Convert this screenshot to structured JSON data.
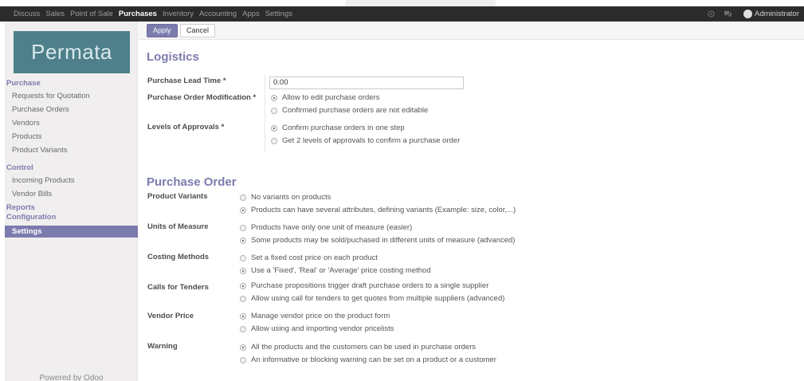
{
  "topnav": {
    "items": [
      "Discuss",
      "Sales",
      "Point of Sale",
      "Purchases",
      "Inventory",
      "Accounting",
      "Apps",
      "Settings"
    ],
    "active": "Purchases",
    "user": "Administrator",
    "icons": [
      "help-circle-icon",
      "chat-icon"
    ]
  },
  "sidebar": {
    "logo": "Permata",
    "sections": [
      {
        "title": "Purchase",
        "items": [
          "Requests for Quotation",
          "Purchase Orders",
          "Vendors",
          "Products",
          "Product Variants"
        ]
      },
      {
        "title": "Control",
        "items": [
          "Incoming Products",
          "Vendor Bills"
        ]
      },
      {
        "title": "Reports",
        "items": []
      },
      {
        "title": "Configuration",
        "items": [
          "Settings"
        ]
      }
    ],
    "active_item": "Settings",
    "footer": "Powered by Odoo"
  },
  "buttons": {
    "apply": "Apply",
    "cancel": "Cancel"
  },
  "logistics": {
    "title": "Logistics",
    "lead_time": {
      "label": "Purchase Lead Time *",
      "value": "0.00"
    },
    "order_modification": {
      "label": "Purchase Order Modification *",
      "options": [
        "Allow to edit purchase orders",
        "Confirmed purchase orders are not editable"
      ],
      "selected": 0
    },
    "approvals": {
      "label": "Levels of Approvals *",
      "options": [
        "Confirm purchase orders in one step",
        "Get 2 levels of approvals to confirm a purchase order"
      ],
      "selected": 0
    }
  },
  "purchase_order": {
    "title": "Purchase Order",
    "groups": [
      {
        "label": "Product Variants",
        "options": [
          "No variants on products",
          "Products can have several attributes, defining variants (Example: size, color,...)"
        ],
        "selected": 1
      },
      {
        "label": "Units of Measure",
        "options": [
          "Products have only one unit of measure (easier)",
          "Some products may be sold/puchased in different units of measure (advanced)"
        ],
        "selected": 1
      },
      {
        "label": "Costing Methods",
        "options": [
          "Set a fixed cost price on each product",
          "Use a 'Fixed', 'Real' or 'Average' price costing method"
        ],
        "selected": 1
      },
      {
        "label": "Calls for Tenders",
        "options": [
          "Purchase propositions trigger draft purchase orders to a single supplier",
          "Allow using call for tenders to get quotes from multiple suppliers (advanced)"
        ],
        "selected": 0
      },
      {
        "label": "Vendor Price",
        "options": [
          "Manage vendor price on the product form",
          "Allow using and importing vendor pricelists"
        ],
        "selected": 0
      },
      {
        "label": "Warning",
        "options": [
          "All the products and the customers can be used in purchase orders",
          "An informative or blocking warning can be set on a product or a customer"
        ],
        "selected": 0
      }
    ]
  }
}
